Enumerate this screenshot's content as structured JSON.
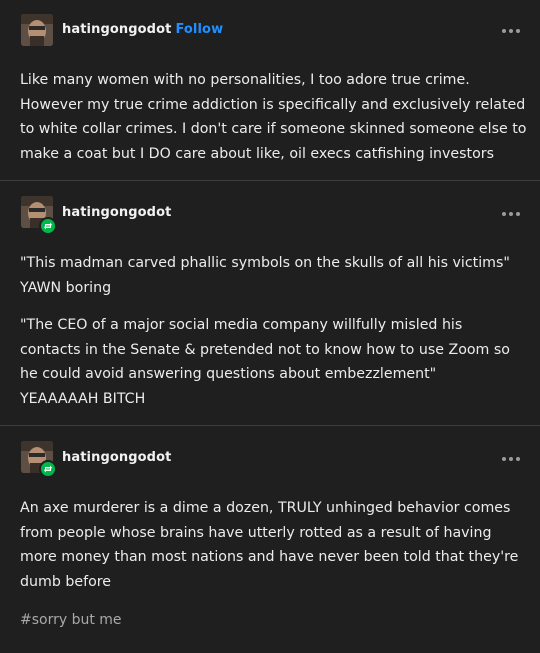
{
  "posts": [
    {
      "username": "hatingongodot",
      "follow_label": "Follow",
      "text": "Like many women with no personalities, I too adore true crime.\nHowever my true crime addiction is specifically and exclusively related\nto white collar crimes. I don't care if someone skinned someone else to\nmake a coat but I DO care about like, oil execs catfishing investors"
    },
    {
      "username": "hatingongodot",
      "paragraph1": "\"This madman carved phallic symbols on the skulls of all his victims\"\nYAWN boring",
      "paragraph2": "\"The CEO of a major social media company willfully misled his\ncontacts in the Senate & pretended not to know how to use Zoom so\nhe could avoid answering questions about embezzlement\"\nYEAAAAAH BITCH"
    },
    {
      "username": "hatingongodot",
      "text": "An axe murderer is a dime a dozen, TRULY unhinged behavior comes\nfrom people whose brains have utterly rotted as a result of having\nmore money than most nations and have never been told that they're\ndumb before",
      "tag": "#sorry but me"
    }
  ],
  "colors": {
    "background": "#1f1f1f",
    "follow": "#1e90ff",
    "reblog_badge": "#00b84a",
    "tag": "#a8a8a8"
  },
  "icons": [
    "avatar",
    "reblog-icon",
    "more-options-icon"
  ]
}
